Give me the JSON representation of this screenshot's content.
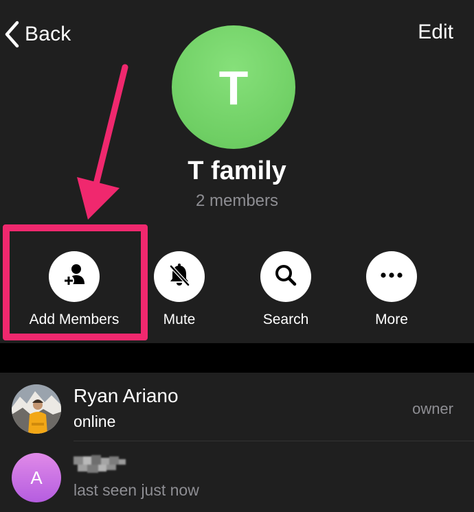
{
  "header": {
    "back_label": "Back",
    "edit_label": "Edit"
  },
  "group": {
    "avatar_letter": "T",
    "avatar_color": "#6fcf64",
    "name": "T family",
    "member_count": "2 members"
  },
  "actions": [
    {
      "label": "Add Members",
      "icon": "add-person-icon"
    },
    {
      "label": "Mute",
      "icon": "bell-slash-icon"
    },
    {
      "label": "Search",
      "icon": "magnifier-icon"
    },
    {
      "label": "More",
      "icon": "ellipsis-icon"
    }
  ],
  "annotation": {
    "highlight_color": "#f0286e"
  },
  "members": [
    {
      "name": "Ryan Ariano",
      "status": "online",
      "role": "owner",
      "status_color": "#ffffff"
    },
    {
      "name": "",
      "avatar_letter": "A",
      "status": "last seen just now",
      "status_color": "#8e8e93"
    }
  ]
}
